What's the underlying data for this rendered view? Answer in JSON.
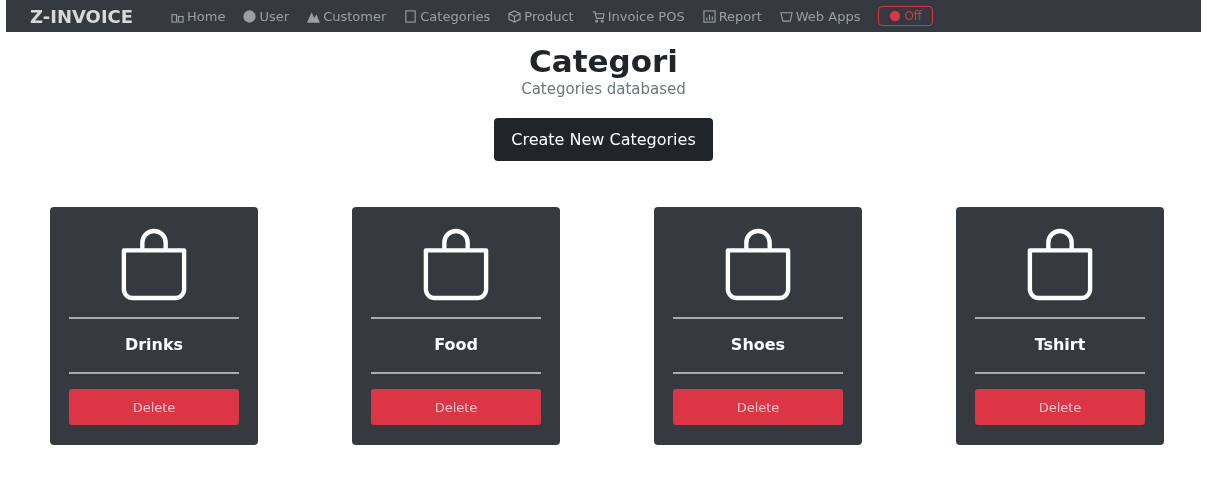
{
  "navbar": {
    "brand": "Z-INVOICE",
    "items": [
      {
        "label": "Home",
        "kind": "home"
      },
      {
        "label": "User",
        "kind": "user"
      },
      {
        "label": "Customer",
        "kind": "users"
      },
      {
        "label": "Categories",
        "kind": "square"
      },
      {
        "label": "Product",
        "kind": "box"
      },
      {
        "label": "Invoice POS",
        "kind": "cart"
      },
      {
        "label": "Report",
        "kind": "report"
      },
      {
        "label": "Web Apps",
        "kind": "apps"
      }
    ],
    "logout": "Off"
  },
  "header": {
    "title": "Categori",
    "subtitle": "Categories databased"
  },
  "create_button": "Create New Categories",
  "categories": [
    {
      "name": "Drinks",
      "action": "Delete"
    },
    {
      "name": "Food",
      "action": "Delete"
    },
    {
      "name": "Shoes",
      "action": "Delete"
    },
    {
      "name": "Tshirt",
      "action": "Delete"
    }
  ]
}
